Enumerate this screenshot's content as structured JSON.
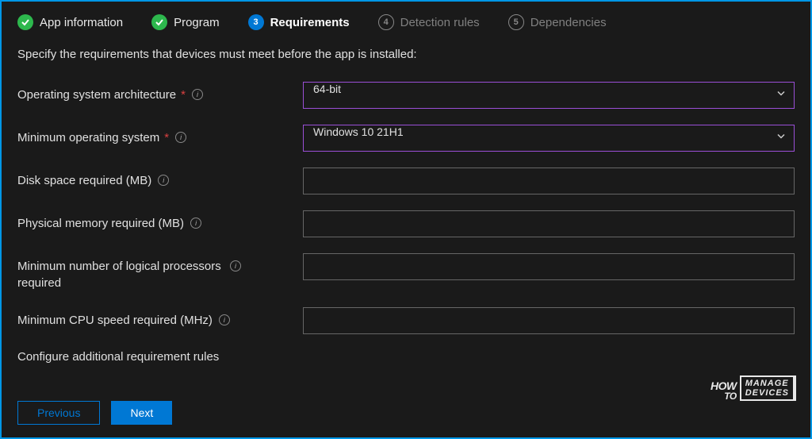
{
  "tabs": [
    {
      "label": "App information",
      "state": "done"
    },
    {
      "label": "Program",
      "state": "done"
    },
    {
      "number": "3",
      "label": "Requirements",
      "state": "current"
    },
    {
      "number": "4",
      "label": "Detection rules",
      "state": "pending"
    },
    {
      "number": "5",
      "label": "Dependencies",
      "state": "pending"
    }
  ],
  "description": "Specify the requirements that devices must meet before the app is installed:",
  "fields": {
    "os_arch": {
      "label": "Operating system architecture",
      "required": true,
      "value": "64-bit"
    },
    "min_os": {
      "label": "Minimum operating system",
      "required": true,
      "value": "Windows 10 21H1"
    },
    "disk": {
      "label": "Disk space required (MB)",
      "required": false,
      "value": ""
    },
    "memory": {
      "label": "Physical memory required (MB)",
      "required": false,
      "value": ""
    },
    "processors": {
      "label": "Minimum number of logical processors required",
      "required": false,
      "value": ""
    },
    "cpu": {
      "label": "Minimum CPU speed required (MHz)",
      "required": false,
      "value": ""
    }
  },
  "additional_rules_heading": "Configure additional requirement rules",
  "buttons": {
    "previous": "Previous",
    "next": "Next"
  },
  "watermark": {
    "how": "HOW",
    "to": "TO",
    "manage": "MANAGE",
    "devices": "DEVICES"
  }
}
